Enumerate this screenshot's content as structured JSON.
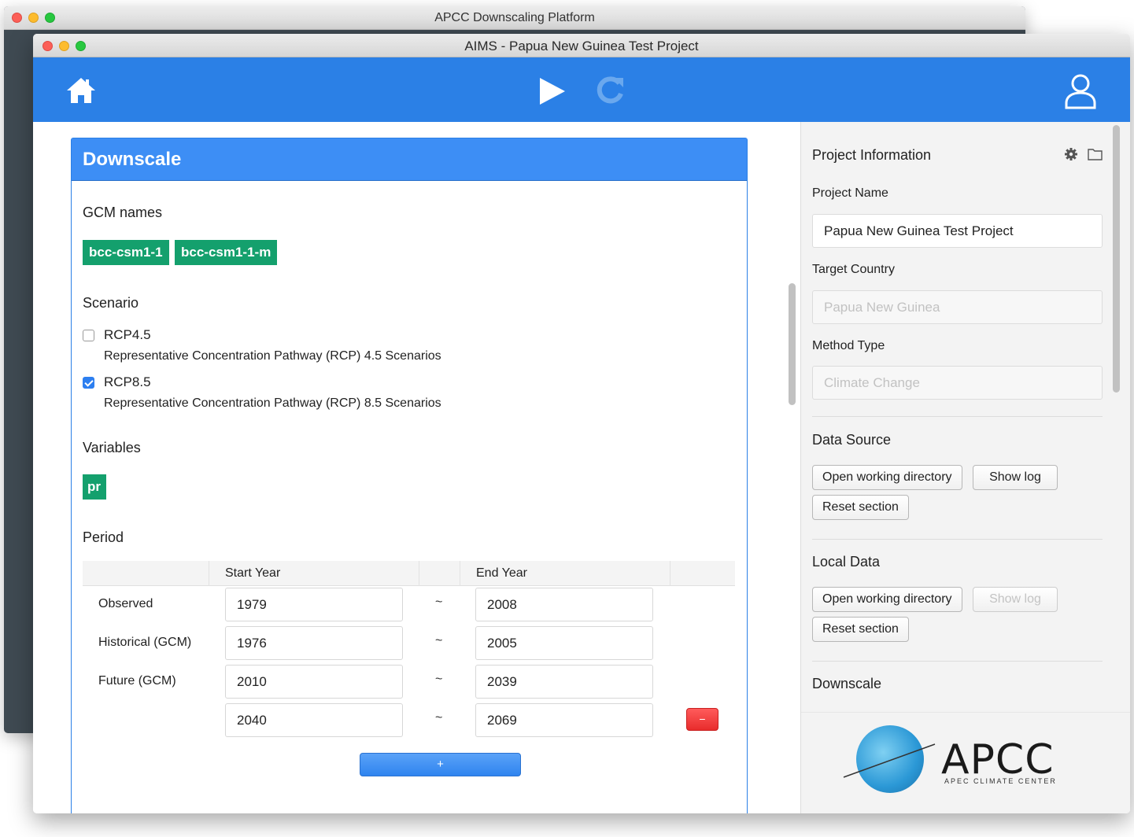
{
  "back_window": {
    "title": "APCC Downscaling Platform"
  },
  "front_window": {
    "title": "AIMS - Papua New Guinea Test Project"
  },
  "toolbar": {
    "home_icon": "home-icon",
    "play_icon": "play-icon",
    "refresh_icon": "refresh-icon",
    "user_icon": "user-icon",
    "accent": "#2b80e6"
  },
  "downscale": {
    "header": "Downscale",
    "gcm_title": "GCM names",
    "gcm_tags": [
      "bcc-csm1-1",
      "bcc-csm1-1-m"
    ],
    "scenario_title": "Scenario",
    "scenarios": [
      {
        "label": "RCP4.5",
        "desc": "Representative Concentration Pathway (RCP) 4.5 Scenarios",
        "checked": false
      },
      {
        "label": "RCP8.5",
        "desc": "Representative Concentration Pathway (RCP) 8.5 Scenarios",
        "checked": true
      }
    ],
    "variables_title": "Variables",
    "variables": [
      "pr"
    ],
    "period_title": "Period",
    "period": {
      "col_start": "Start Year",
      "col_end": "End Year",
      "separator": "~",
      "rows": [
        {
          "label": "Observed",
          "start": "1979",
          "end": "2008"
        },
        {
          "label": "Historical (GCM)",
          "start": "1976",
          "end": "2005"
        },
        {
          "label": "Future (GCM)",
          "start": "2010",
          "end": "2039"
        },
        {
          "label": "",
          "start": "2040",
          "end": "2069"
        }
      ],
      "remove_label": "−",
      "add_label": "+"
    }
  },
  "sidebar": {
    "project_info_title": "Project Information",
    "project_name_label": "Project Name",
    "project_name_value": "Papua New Guinea Test Project",
    "target_country_label": "Target Country",
    "target_country_value": "Papua New Guinea",
    "method_type_label": "Method Type",
    "method_type_value": "Climate Change",
    "data_source_title": "Data Source",
    "local_data_title": "Local Data",
    "downscale_title": "Downscale",
    "open_dir_label": "Open working directory",
    "show_log_label": "Show log",
    "reset_label": "Reset section",
    "logo_text": "APCC",
    "logo_sub": "APEC CLIMATE CENTER"
  }
}
